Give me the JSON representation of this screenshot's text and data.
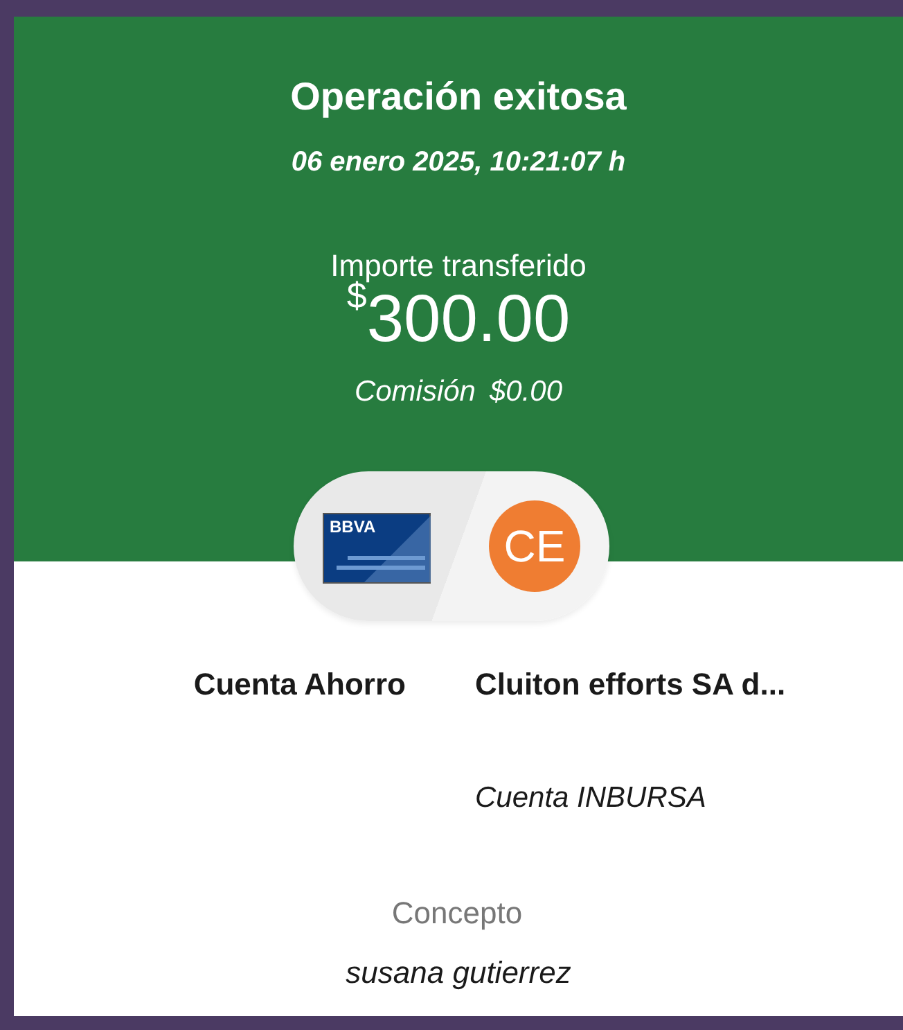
{
  "header": {
    "title": "Operación exitosa",
    "datetime": "06 enero 2025, 10:21:07 h"
  },
  "amount": {
    "label": "Importe transferido",
    "currency": "$",
    "value": "300.00"
  },
  "fee": {
    "label": "Comisión",
    "value": "$0.00"
  },
  "source": {
    "bank_logo": "BBVA",
    "name": "Cuenta Ahorro"
  },
  "destination": {
    "initials": "CE",
    "color": "#ef7d32",
    "name": "Cluiton efforts SA d...",
    "account": "Cuenta INBURSA"
  },
  "concept": {
    "label": "Concepto",
    "value": "susana gutierrez"
  }
}
